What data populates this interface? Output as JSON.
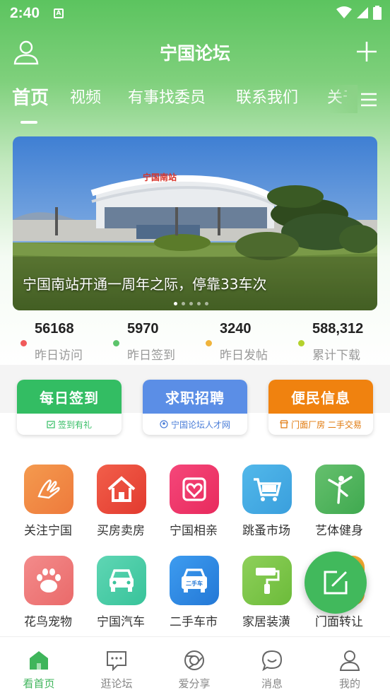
{
  "status_bar": {
    "time": "2:40",
    "notice_glyph": "A"
  },
  "topbar": {
    "title": "宁国论坛",
    "left_icon": "user-icon",
    "right_icon": "plus-icon"
  },
  "tabs": [
    {
      "label": "首页",
      "active": true
    },
    {
      "label": "视频",
      "active": false
    },
    {
      "label": "有事找委员",
      "active": false
    },
    {
      "label": "联系我们",
      "active": false
    },
    {
      "label": "关于",
      "active": false
    }
  ],
  "banner": {
    "caption": "宁国南站开通一周年之际，停靠33车次",
    "sign": "宁国南站",
    "page_count": 5,
    "current_page": 1
  },
  "stats": [
    {
      "value": "56168",
      "label": "昨日访问",
      "color": "#f05a5a"
    },
    {
      "value": "5970",
      "label": "昨日签到",
      "color": "#5cc46b"
    },
    {
      "value": "3240",
      "label": "昨日发帖",
      "color": "#f0b43c"
    },
    {
      "value": "588,312",
      "label": "累计下载",
      "color": "#b4d22d"
    }
  ],
  "quick_actions": [
    {
      "title": "每日签到",
      "subtitle": "签到有礼",
      "color": "#33bd63",
      "sub_color": "#33bd63"
    },
    {
      "title": "求职招聘",
      "subtitle": "宁国论坛人才网",
      "color": "#5b8ee6",
      "sub_color": "#4a7dd8"
    },
    {
      "title": "便民信息",
      "subtitle": "门面厂房 二手交易",
      "color": "#f0820f",
      "sub_color": "#e0780a"
    }
  ],
  "grid": [
    {
      "label": "关注宁国",
      "icon": "hands-icon",
      "color1": "#f49a4e",
      "color2": "#ee7a3c"
    },
    {
      "label": "买房卖房",
      "icon": "house-icon",
      "color1": "#f25f4a",
      "color2": "#e23a2f"
    },
    {
      "label": "宁国相亲",
      "icon": "heart-icon",
      "color1": "#f5477a",
      "color2": "#e82a5d"
    },
    {
      "label": "跳蚤市场",
      "icon": "cart-icon",
      "color1": "#52b8ea",
      "color2": "#3a9fdd"
    },
    {
      "label": "艺体健身",
      "icon": "gymnast-icon",
      "color1": "#66c06e",
      "color2": "#3fa94f"
    },
    {
      "label": "花鸟宠物",
      "icon": "paw-icon",
      "color1": "#f38b8b",
      "color2": "#ea6a6a"
    },
    {
      "label": "宁国汽车",
      "icon": "car-icon",
      "color1": "#5fd6b4",
      "color2": "#38c39a"
    },
    {
      "label": "二手车市",
      "icon": "used-car-icon",
      "color1": "#3d9cf0",
      "color2": "#2478d6",
      "badge": "二手车"
    },
    {
      "label": "家居装潢",
      "icon": "paint-roller-icon",
      "color1": "#8ed05a",
      "color2": "#6cbb3a"
    },
    {
      "label": "门面转让",
      "icon": "shop-icon",
      "color1": "#f5b43c",
      "color2": "#ee9a22"
    }
  ],
  "fab": {
    "icon": "compose-icon"
  },
  "bottom_nav": [
    {
      "label": "看首页",
      "icon": "home-icon",
      "active": true
    },
    {
      "label": "逛论坛",
      "icon": "forum-icon",
      "active": false
    },
    {
      "label": "爱分享",
      "icon": "share-icon",
      "active": false
    },
    {
      "label": "消息",
      "icon": "message-icon",
      "active": false
    },
    {
      "label": "我的",
      "icon": "profile-icon",
      "active": false
    }
  ]
}
